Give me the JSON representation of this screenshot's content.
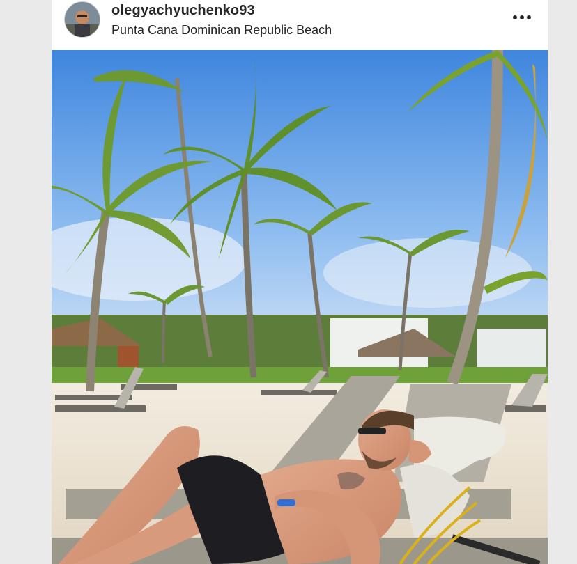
{
  "post": {
    "username": "olegyachyuchenko93",
    "location": "Punta Cana Dominican Republic Beach",
    "avatar_icon": "profile-avatar",
    "more_icon": "more-horizontal-icon"
  },
  "colors": {
    "sky": "#4a8fe0",
    "sand": "#ece3d2",
    "palm_leaf": "#6f9a2a",
    "shorts": "#1d1d22",
    "lounger": "#a9a59a"
  }
}
